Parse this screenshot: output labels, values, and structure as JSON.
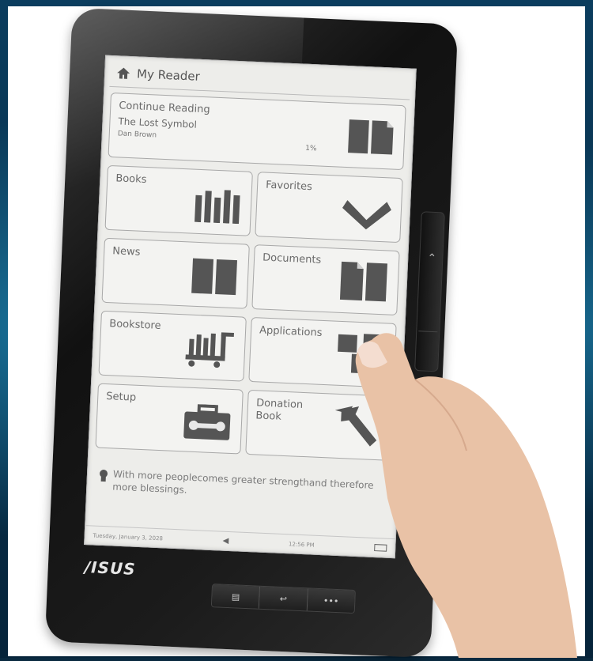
{
  "header": {
    "title": "My Reader"
  },
  "continue_reading": {
    "label": "Continue Reading",
    "book_title": "The Lost Symbol",
    "author": "Dan Brown",
    "progress": "1%"
  },
  "tiles": [
    {
      "label": "Books",
      "icon": "books-icon"
    },
    {
      "label": "Favorites",
      "icon": "heart-icon"
    },
    {
      "label": "News",
      "icon": "newspaper-icon"
    },
    {
      "label": "Documents",
      "icon": "documents-icon"
    },
    {
      "label": "Bookstore",
      "icon": "cart-icon"
    },
    {
      "label": "Applications",
      "icon": "applications-icon"
    },
    {
      "label": "Setup",
      "icon": "toolbox-icon"
    },
    {
      "label": "Donation Book",
      "icon": "donation-arrow-icon"
    }
  ],
  "tip": {
    "text": "With more peoplecomes greater strengthand therefore more blessings."
  },
  "status_bar": {
    "date": "Tuesday, January 3, 2028",
    "time": "12:56 PM"
  },
  "device": {
    "brand": "/ISUS"
  },
  "colors": {
    "screen": "#ededea",
    "bezel": "#1b1b1b",
    "tile_border": "#a8a8a8",
    "icon": "#555555"
  }
}
